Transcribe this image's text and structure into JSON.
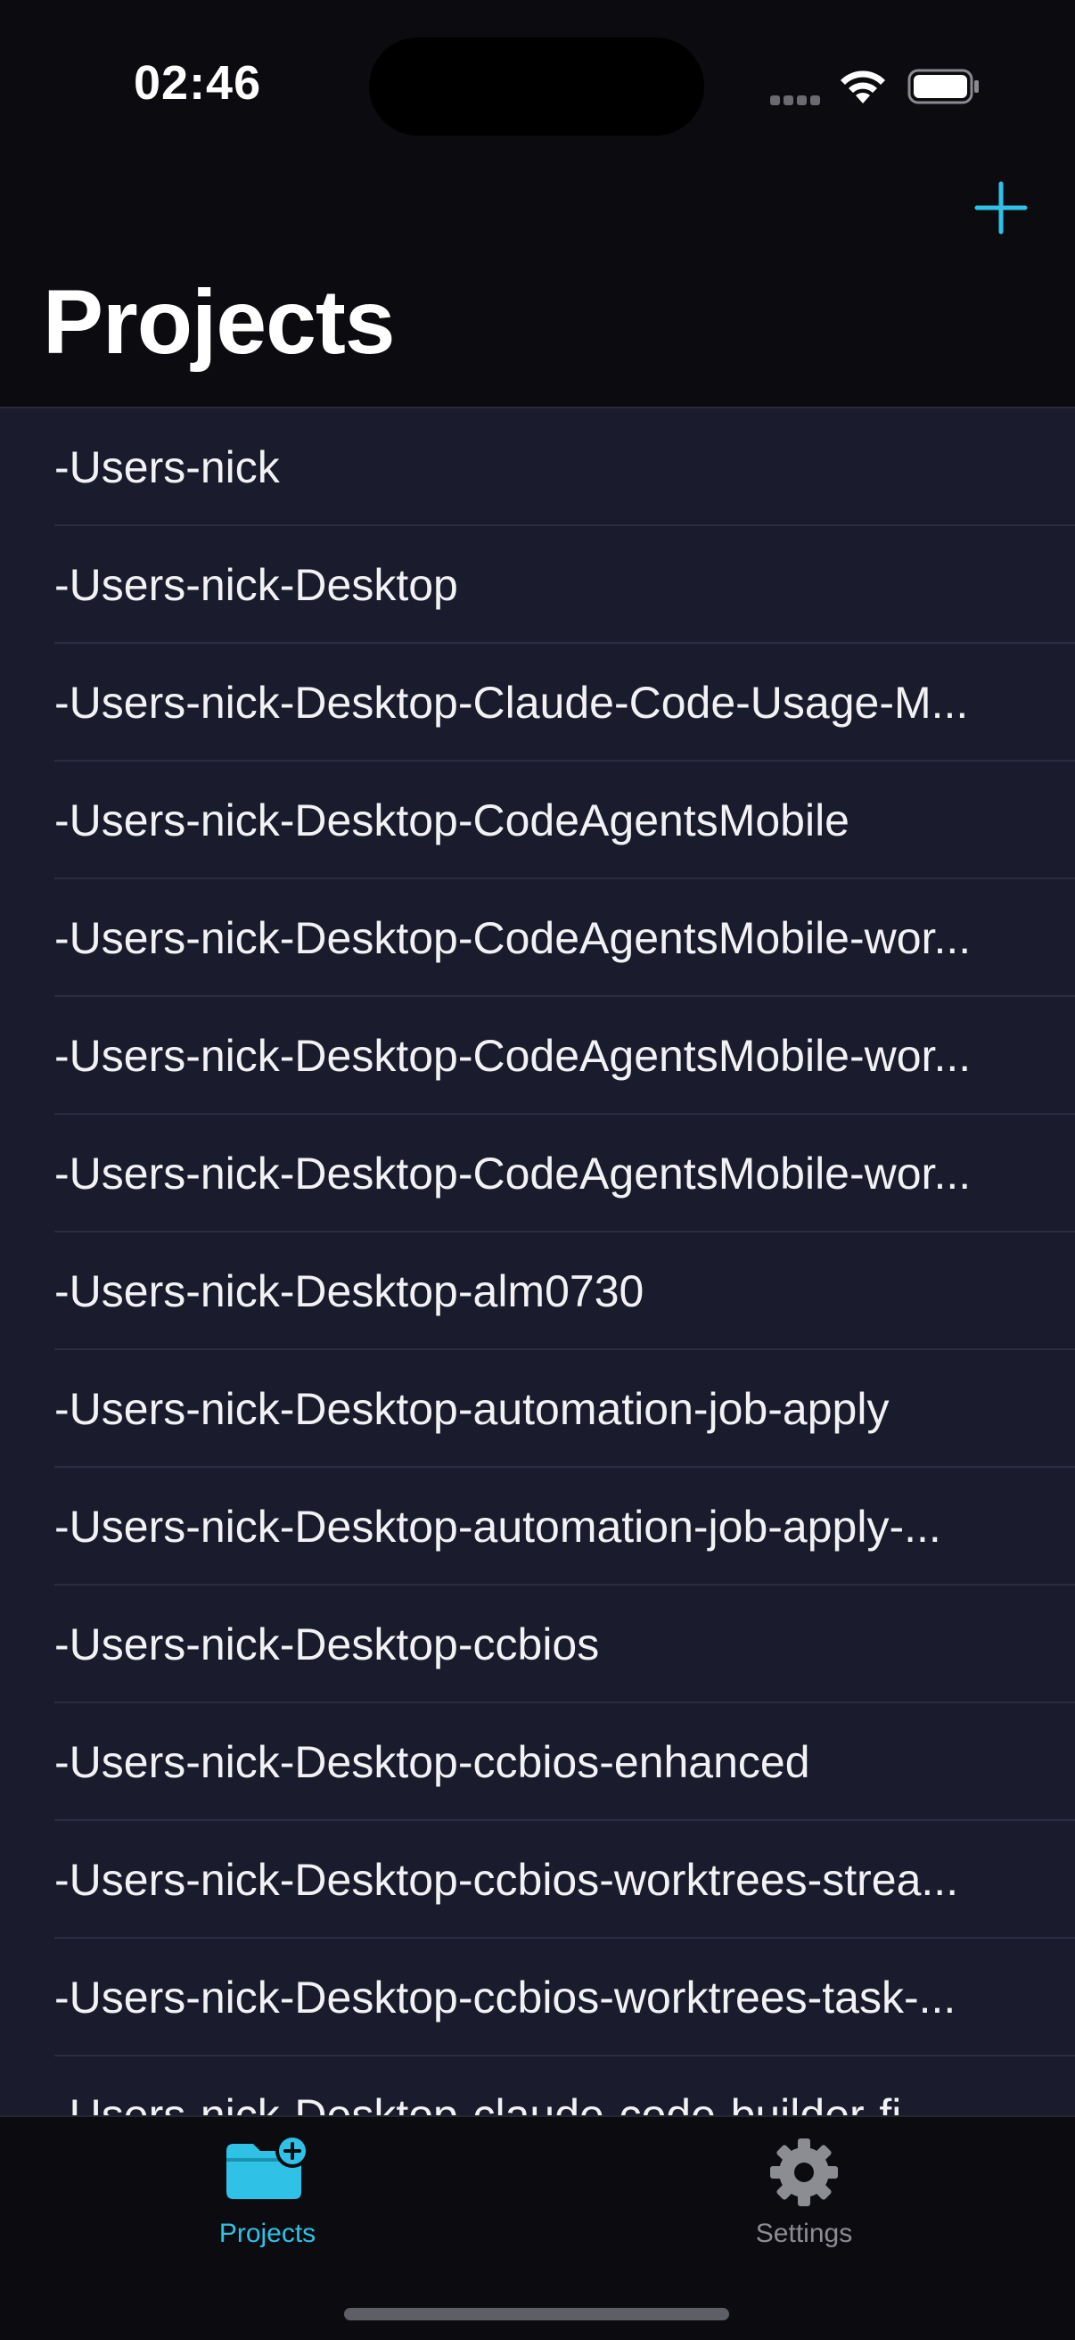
{
  "status_bar": {
    "time": "02:46"
  },
  "nav": {
    "title": "Projects",
    "add_icon": "plus-icon",
    "accent_color": "#2fc1e6"
  },
  "projects": [
    "-Users-nick",
    "-Users-nick-Desktop",
    "-Users-nick-Desktop-Claude-Code-Usage-M...",
    "-Users-nick-Desktop-CodeAgentsMobile",
    "-Users-nick-Desktop-CodeAgentsMobile-wor...",
    "-Users-nick-Desktop-CodeAgentsMobile-wor...",
    "-Users-nick-Desktop-CodeAgentsMobile-wor...",
    "-Users-nick-Desktop-alm0730",
    "-Users-nick-Desktop-automation-job-apply",
    "-Users-nick-Desktop-automation-job-apply-...",
    "-Users-nick-Desktop-ccbios",
    "-Users-nick-Desktop-ccbios-enhanced",
    "-Users-nick-Desktop-ccbios-worktrees-strea...",
    "-Users-nick-Desktop-ccbios-worktrees-task-...",
    "-Users-nick-Desktop-claude-code-builder-fi..."
  ],
  "tab_bar": {
    "tabs": [
      {
        "label": "Projects",
        "icon": "folder-plus-icon",
        "selected": true
      },
      {
        "label": "Settings",
        "icon": "gear-icon",
        "selected": false
      }
    ]
  }
}
